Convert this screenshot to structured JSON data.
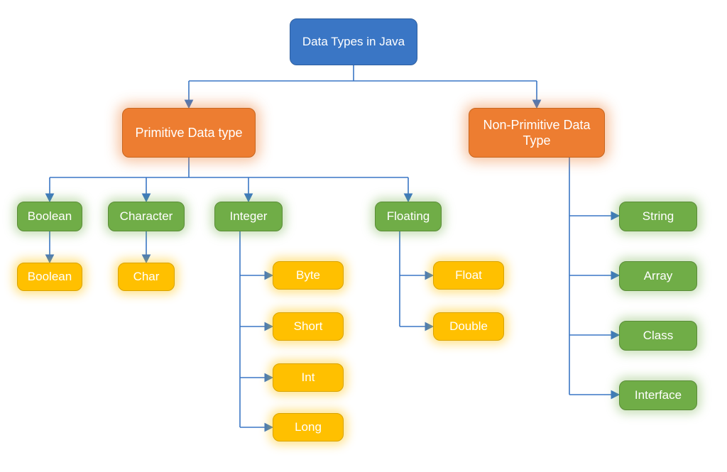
{
  "root": {
    "label": "Data Types in Java"
  },
  "primitive": {
    "label": "Primitive Data type",
    "children": {
      "boolean": {
        "label": "Boolean",
        "leaf": {
          "label": "Boolean"
        }
      },
      "character": {
        "label": "Character",
        "leaf": {
          "label": "Char"
        }
      },
      "integer": {
        "label": "Integer",
        "leaves": [
          "Byte",
          "Short",
          "Int",
          "Long"
        ]
      },
      "floating": {
        "label": "Floating",
        "leaves": [
          "Float",
          "Double"
        ]
      }
    }
  },
  "nonprimitive": {
    "label": "Non-Primitive Data Type",
    "leaves": [
      "String",
      "Array",
      "Class",
      "Interface"
    ]
  },
  "colors": {
    "blue": "#3a76c5",
    "orange": "#ed7d31",
    "green": "#70ad47",
    "yellow": "#ffc000"
  }
}
